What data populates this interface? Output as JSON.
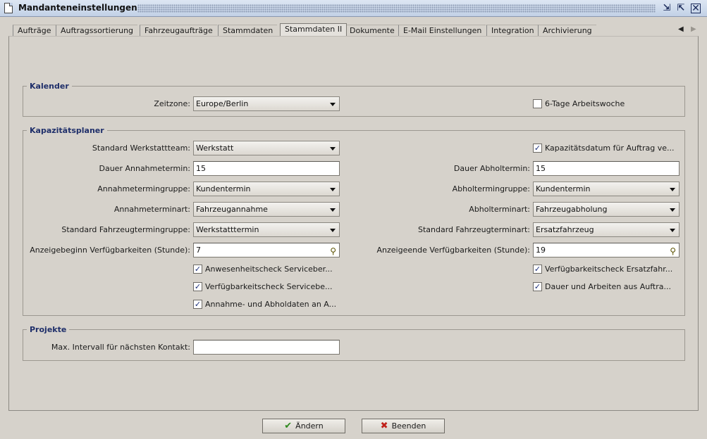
{
  "window": {
    "title": "Mandanteneinstellungen",
    "controls": [
      "restore-icon",
      "maximize-icon",
      "close-icon"
    ]
  },
  "tabs": [
    {
      "label": "Aufträge"
    },
    {
      "label": "Auftragssortierung"
    },
    {
      "label": "Fahrzeugaufträge"
    },
    {
      "label": "Stammdaten"
    },
    {
      "label": "Stammdaten II",
      "active": true
    },
    {
      "label": "Dokumente"
    },
    {
      "label": "E-Mail Einstellungen"
    },
    {
      "label": "Integration"
    },
    {
      "label": "Archivierung"
    }
  ],
  "kalender": {
    "legend": "Kalender",
    "zeitzone_label": "Zeitzone:",
    "zeitzone_value": "Europe/Berlin",
    "sechs_tage_label": "6-Tage Arbeitswoche",
    "sechs_tage_checked": false
  },
  "kapazitaet": {
    "legend": "Kapazitätsplaner",
    "left": {
      "werkstattteam_label": "Standard Werkstattteam:",
      "werkstattteam_value": "Werkstatt",
      "annahme_dauer_label": "Dauer Annahmetermin:",
      "annahme_dauer_value": "15",
      "annahmegruppe_label": "Annahmetermingruppe:",
      "annahmegruppe_value": "Kundentermin",
      "annahmeart_label": "Annahmeterminart:",
      "annahmeart_value": "Fahrzeugannahme",
      "fzgruppe_label": "Standard Fahrzeugtermingruppe:",
      "fzgruppe_value": "Werkstatttermin",
      "beginn_label": "Anzeigebeginn Verfügbarkeiten (Stunde):",
      "beginn_value": "7",
      "check1": "Anwesenheitscheck Serviceber...",
      "check2": "Verfügbarkeitscheck Servicebe...",
      "check3": "Annahme- und Abholdaten an A..."
    },
    "right": {
      "kapdatum_label": "Kapazitätsdatum für Auftrag ve...",
      "abhol_dauer_label": "Dauer Abholtermin:",
      "abhol_dauer_value": "15",
      "abholgruppe_label": "Abholtermingruppe:",
      "abholgruppe_value": "Kundentermin",
      "abholart_label": "Abholterminart:",
      "abholart_value": "Fahrzeugabholung",
      "fzart_label": "Standard Fahrzeugterminart:",
      "fzart_value": "Ersatzfahrzeug",
      "ende_label": "Anzeigeende Verfügbarkeiten (Stunde):",
      "ende_value": "19",
      "check1": "Verfügbarkeitscheck Ersatzfahr...",
      "check2": "Dauer und Arbeiten aus Auftra..."
    }
  },
  "projekte": {
    "legend": "Projekte",
    "intervall_label": "Max. Intervall für nächsten Kontakt:",
    "intervall_value": ""
  },
  "buttons": {
    "aendern": "Ändern",
    "beenden": "Beenden"
  }
}
